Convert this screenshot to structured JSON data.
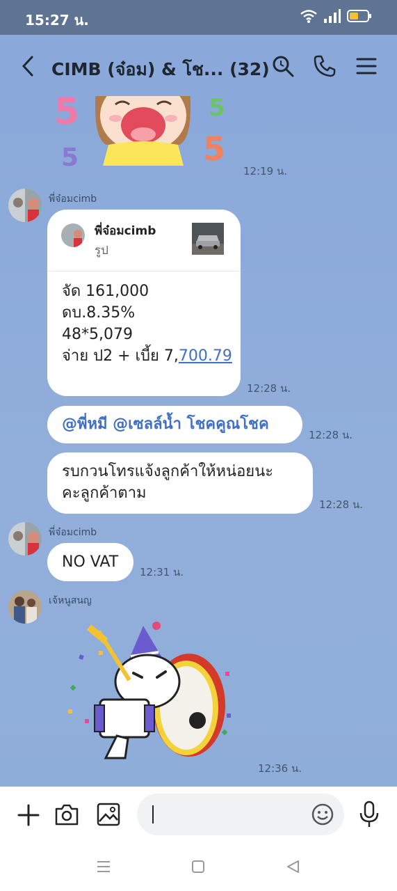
{
  "status": {
    "time": "15:27 น."
  },
  "header": {
    "title": "CIMB (จ๋อม) & โช... (32)"
  },
  "messages": {
    "m1_time": "12:19 น.",
    "m2_sender": "พี่จ๋อมcimb",
    "m2_reply_name": "พี่จ๋อมcimb",
    "m2_reply_type": "รูป",
    "m2_line1": "จัด 161,000",
    "m2_line2": "ดบ.8.35%",
    "m2_line3": "48*5,079",
    "m2_line4_prefix": "จ่าย ป2 + เบี้ย 7,",
    "m2_line4_link": "700.79",
    "m2_time": "12:28 น.",
    "m3_text": "@พี่หมี @เซลล์น้ำ โชคคูณโชค",
    "m3_time": "12:28 น.",
    "m4_line1": "รบกวนโทรแจ้งลูกค้าให้หน่อยนะ",
    "m4_line2": "คะลูกค้าตาม",
    "m4_time": "12:28 น.",
    "m5_sender": "พี่จ๋อมcimb",
    "m5_text": "NO VAT",
    "m5_time": "12:31 น.",
    "m6_sender": "เจ้หนูสนญ",
    "m6_time": "12:36 น."
  },
  "colors": {
    "chat_bg": "#8aa8d9",
    "status_bg": "#5f7393",
    "mention": "#3f6fc6"
  }
}
